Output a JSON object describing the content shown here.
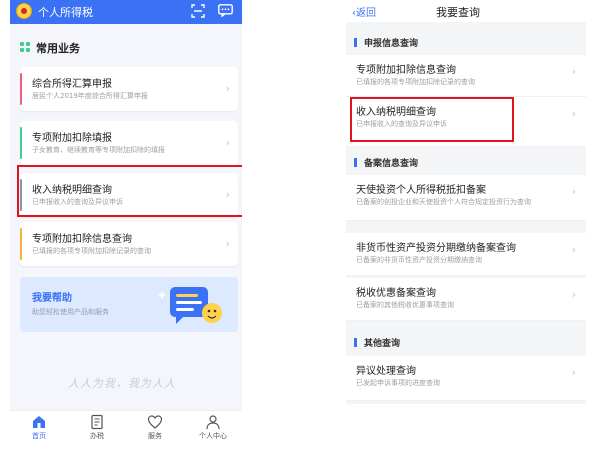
{
  "left": {
    "app_title": "个人所得税",
    "section_title": "常用业务",
    "cards": [
      {
        "title": "综合所得汇算申报",
        "subtitle": "居民个人2019年度综合所得汇算申报",
        "color": "#f0607a"
      },
      {
        "title": "专项附加扣除填报",
        "subtitle": "子女教育、继续教育等专项附加扣除的填报",
        "color": "#3ccf8e"
      },
      {
        "title": "收入纳税明细查询",
        "subtitle": "已申报收入的查询及异议申诉",
        "color": "#8b93a1"
      },
      {
        "title": "专项附加扣除信息查询",
        "subtitle": "已填报的各项专项附加扣除记录的查询",
        "color": "#f5b13d"
      }
    ],
    "help": {
      "title": "我要帮助",
      "subtitle": "助您轻松使用产品和服务"
    },
    "slogan": "人人为我，我为人人",
    "tabs": [
      "首页",
      "办税",
      "服务",
      "个人中心"
    ],
    "accent": "#3b71f4"
  },
  "right": {
    "back_label": "返回",
    "title": "我要查询",
    "groups": [
      {
        "title": "申报信息查询",
        "rows": [
          {
            "title": "专项附加扣除信息查询",
            "subtitle": "已填报的各项专项附加扣除记录的查询"
          },
          {
            "title": "收入纳税明细查询",
            "subtitle": "已申报收入的查询及异议申诉"
          }
        ]
      },
      {
        "title": "备案信息查询",
        "rows": [
          {
            "title": "天使投资个人所得税抵扣备案",
            "subtitle": "已备案的创投企业和天使投资个人符合规定投资行为查询"
          },
          {
            "title": "非货币性资产投资分期缴纳备案查询",
            "subtitle": "已备案的非货币性资产投资分期缴纳查询"
          },
          {
            "title": "税收优惠备案查询",
            "subtitle": "已备案的其他税收优惠事项查询"
          }
        ]
      },
      {
        "title": "其他查询",
        "rows": [
          {
            "title": "异议处理查询",
            "subtitle": "已发起申诉事项的进度查询"
          }
        ]
      }
    ]
  },
  "highlight_color": "#e0141e"
}
